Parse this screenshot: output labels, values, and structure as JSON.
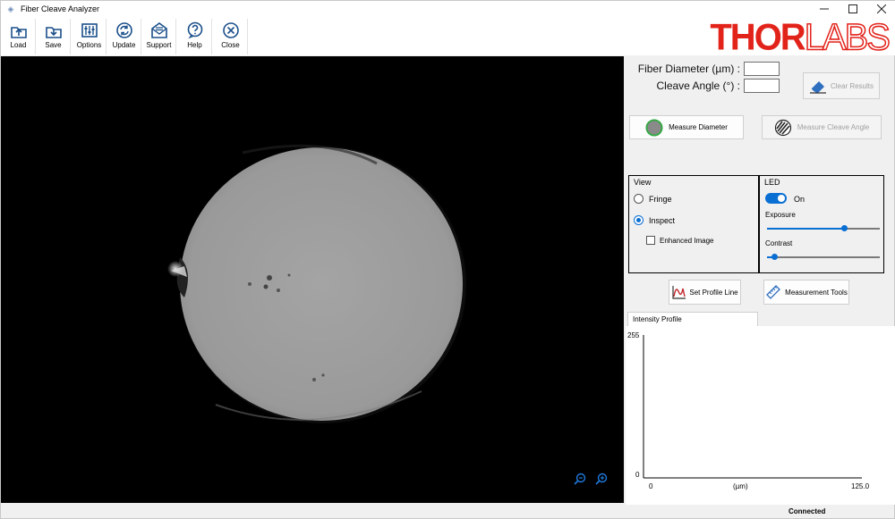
{
  "window": {
    "title": "Fiber Cleave Analyzer"
  },
  "toolbar": {
    "load": "Load",
    "save": "Save",
    "options": "Options",
    "update": "Update",
    "support": "Support",
    "help": "Help",
    "close": "Close"
  },
  "brand": {
    "logo_bold": "THOR",
    "logo_light": "LABS",
    "color": "#e2231a"
  },
  "results": {
    "fiber_diameter_label": "Fiber Diameter (µm) :",
    "fiber_diameter_value": "",
    "cleave_angle_label": "Cleave Angle (°) :",
    "cleave_angle_value": "",
    "clear_results": "Clear Results"
  },
  "measure": {
    "diameter_button": "Measure Diameter",
    "cleave_angle_button": "Measure Cleave Angle"
  },
  "view_group": {
    "title": "View",
    "fringe": "Fringe",
    "inspect": "Inspect",
    "enhanced_image": "Enhanced Image",
    "selected": "Inspect",
    "enhanced_checked": false
  },
  "led_group": {
    "title": "LED",
    "toggle_label": "On",
    "led_on": true,
    "exposure_label": "Exposure",
    "exposure_level": 0.68,
    "contrast_label": "Contrast",
    "contrast_level": 0.06
  },
  "tools": {
    "set_profile_line": "Set Profile Line",
    "measurement_tools": "Measurement Tools"
  },
  "intensity_profile": {
    "tab_label": "Intensity Profile",
    "y_max": "255",
    "y_min": "0",
    "x_min": "0",
    "x_unit": "(µm)",
    "x_max": "125.0"
  },
  "status": {
    "connection": "Connected"
  },
  "colors": {
    "accent": "#0a6fd3",
    "brand_red": "#e2231a"
  }
}
